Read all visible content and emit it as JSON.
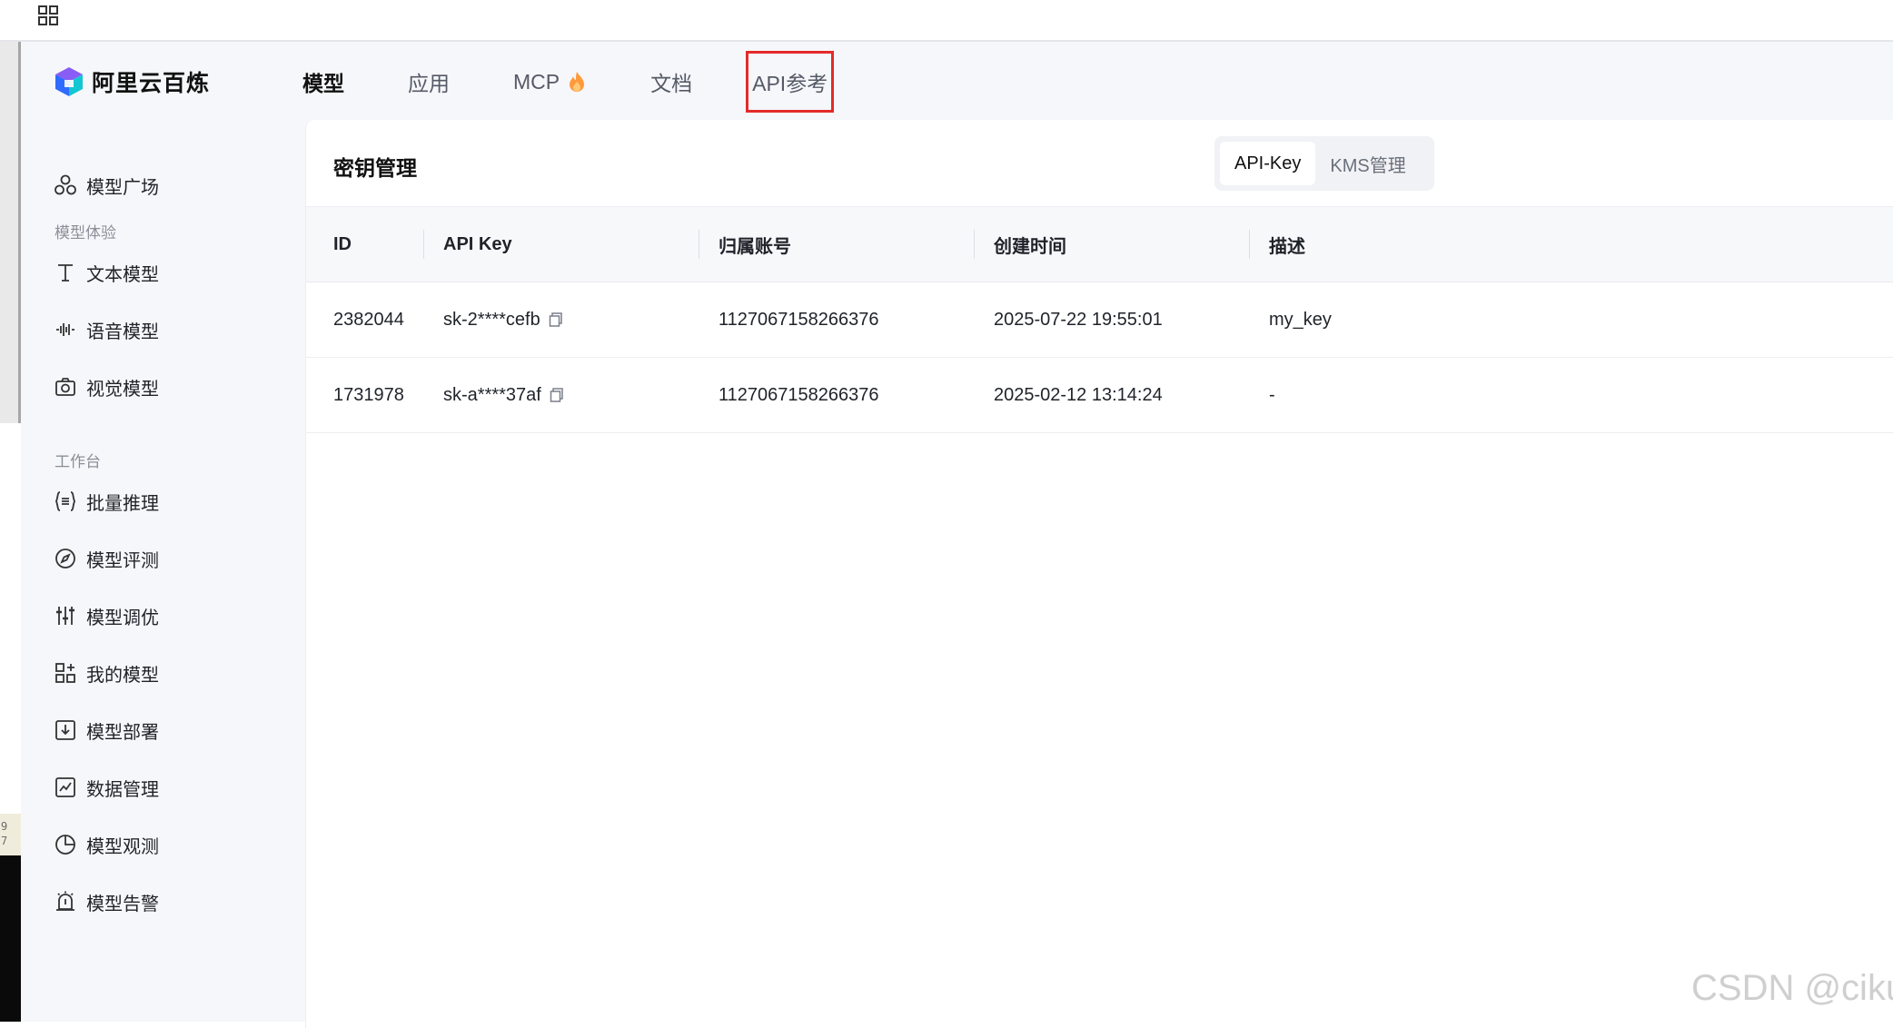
{
  "brand": {
    "name": "阿里云百炼",
    "logo_icon": "bailian-logo"
  },
  "topnav": [
    {
      "label": "模型",
      "active": true
    },
    {
      "label": "应用",
      "active": false
    },
    {
      "label": "MCP",
      "active": false,
      "icon": "fire-icon"
    },
    {
      "label": "文档",
      "active": false
    },
    {
      "label": "API参考",
      "active": false,
      "highlighted": true
    }
  ],
  "sidebar": {
    "top_item": {
      "label": "模型广场",
      "icon": "cube-network-icon"
    },
    "group1_label": "模型体验",
    "group1": [
      {
        "label": "文本模型",
        "icon": "text-t-icon"
      },
      {
        "label": "语音模型",
        "icon": "waveform-icon"
      },
      {
        "label": "视觉模型",
        "icon": "camera-icon"
      }
    ],
    "group2_label": "工作台",
    "group2": [
      {
        "label": "批量推理",
        "icon": "braces-list-icon"
      },
      {
        "label": "模型评测",
        "icon": "compass-icon"
      },
      {
        "label": "模型调优",
        "icon": "sliders-icon"
      },
      {
        "label": "我的模型",
        "icon": "grid-plus-icon"
      },
      {
        "label": "模型部署",
        "icon": "download-box-icon"
      },
      {
        "label": "数据管理",
        "icon": "chart-box-icon"
      },
      {
        "label": "模型观测",
        "icon": "pie-chart-icon"
      },
      {
        "label": "模型告警",
        "icon": "alarm-bell-icon"
      }
    ]
  },
  "panel": {
    "title": "密钥管理",
    "segments": [
      {
        "label": "API-Key",
        "active": true
      },
      {
        "label": "KMS管理",
        "active": false
      }
    ]
  },
  "table": {
    "columns": [
      "ID",
      "API Key",
      "归属账号",
      "创建时间",
      "描述"
    ],
    "rows": [
      {
        "id": "2382044",
        "api_key": "sk-2****cefb",
        "account": "1127067158266376",
        "created": "2025-07-22 19:55:01",
        "desc": "my_key"
      },
      {
        "id": "1731978",
        "api_key": "sk-a****37af",
        "account": "1127067158266376",
        "created": "2025-02-12 13:14:24",
        "desc": "-"
      }
    ]
  },
  "edge_text": "9\n7",
  "watermark": "CSDN @ciku",
  "colors": {
    "highlight_box": "#e42a2a",
    "app_bg": "#f6f7fa",
    "panel_bg": "#ffffff"
  }
}
